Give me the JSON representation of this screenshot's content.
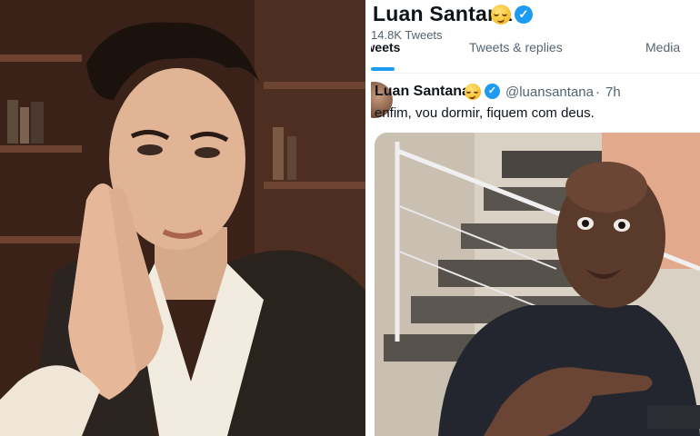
{
  "profile": {
    "name": "Luan Santana",
    "tweet_count": "14.8K Tweets",
    "verified": true
  },
  "tabs": [
    {
      "label": "Tweets",
      "active": true
    },
    {
      "label": "Tweets & replies",
      "active": false
    },
    {
      "label": "Media",
      "active": false
    }
  ],
  "tweet": {
    "author_name": "Luan Santana",
    "handle": "@luansantana",
    "separator": "·",
    "time": "7h",
    "text": "enfim, vou dormir, fiquem com deus."
  },
  "icons": {
    "verified": "verified-badge-icon",
    "emoji": "smirking-face-emoji"
  },
  "colors": {
    "accent": "#1d9bf0",
    "text_primary": "#0f1419",
    "text_secondary": "#536471"
  }
}
